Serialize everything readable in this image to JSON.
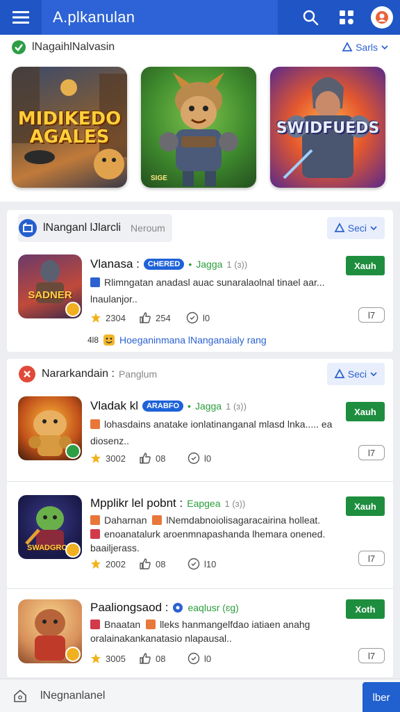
{
  "app_bar": {
    "title": "A.plkanulan"
  },
  "featured": {
    "title": "lNagaihlNalvasin",
    "sort_label": "Sarls",
    "tiles": [
      {
        "logo_line1": "MIDIKEDO",
        "logo_line2": "AGALES",
        "sub": ""
      },
      {
        "logo_line1": "",
        "logo_line2": "",
        "sub": "SIGE"
      },
      {
        "logo_line1": "SWIDFUEDS",
        "logo_line2": "",
        "sub": ""
      }
    ]
  },
  "section1": {
    "title": "lNanganl lJlarcli",
    "subtitle": "Neroum",
    "sort_label": "Seci",
    "app": {
      "name": "Vlanasa :",
      "tag": "CHERED",
      "developer": "Jagga",
      "meta": "1 (ɜ))",
      "description": "Rlimngatan anadasl auac sunaralaolnal tinael aar... lnaulanjor..",
      "rating": "2304",
      "likes": "254",
      "views": "l0",
      "install_label": "Xauh",
      "rate_label": "l7",
      "icon_caption": "SADNER",
      "promo_num": "4l8",
      "promo_text": "Hoeganinmana lNanganaialy rang"
    }
  },
  "section2": {
    "title": "Nararkandain :",
    "subtitle": "Panglum",
    "sort_label": "Seci",
    "apps": [
      {
        "name": "Vladak kl",
        "tag": "ARABFO",
        "developer": "Jagga",
        "meta": "1 (ɜ))",
        "description": "lohasdains anatake ionlatinanganal mlasd lnka..... ea diosenz..",
        "rating": "3002",
        "likes": "08",
        "views": "l0",
        "install_label": "Xauh",
        "rate_label": "l7"
      },
      {
        "name": "Mpplikr lel pobnt :",
        "tag": "",
        "developer": "Eapgea",
        "meta": "1 (ɜ))",
        "description_line1": "Daharnan",
        "description_line1b": "lNemdabnoiolisagaracairina holleat.",
        "description_line2": "enoanatalurk aroenmnapashanda lhemara onened. baailjerass.",
        "rating": "2002",
        "likes": "08",
        "views": "l10",
        "install_label": "Xauh",
        "rate_label": "l7",
        "icon_caption": "SWADGROD"
      },
      {
        "name": "Paaliongsaod :",
        "tag": "",
        "developer": "eaqlusr (ɛg)",
        "meta": "",
        "description_line1": "Bnaatan",
        "description_line1b": "lleks hanmangelfdao iatiaen anahg",
        "description_line2": "oralainakankanatasio nlapausal..",
        "rating": "3005",
        "likes": "08",
        "views": "l0",
        "install_label": "Xoth",
        "rate_label": "l7"
      }
    ]
  },
  "bottom_bar": {
    "label": "lNegnanlanel",
    "button_label": "lber"
  },
  "colors": {
    "primary": "#1f55c4",
    "install_green": "#1e8e3e",
    "link_blue": "#2b62d0"
  },
  "icons": [
    "menu-icon",
    "search-icon",
    "grid-icon",
    "profile-icon",
    "check-badge-icon",
    "sort-icon",
    "star-icon",
    "thumb-up-icon",
    "eye-icon",
    "home-icon"
  ]
}
